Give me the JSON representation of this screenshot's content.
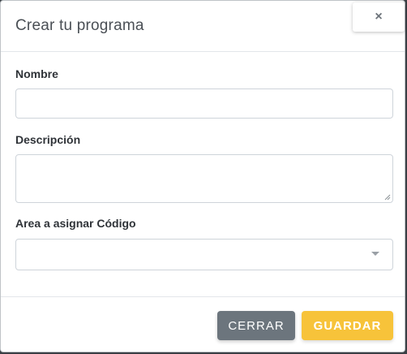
{
  "modal": {
    "title": "Crear tu programa",
    "close_glyph": "×"
  },
  "form": {
    "name_label": "Nombre",
    "name_value": "",
    "description_label": "Descripción",
    "description_value": "",
    "area_label": "Area a asignar Código",
    "area_selected": ""
  },
  "footer": {
    "cancel_label": "CERRAR",
    "save_label": "GUARDAR"
  },
  "colors": {
    "save_button": "#f7c33a",
    "cancel_button": "#6c757d"
  }
}
